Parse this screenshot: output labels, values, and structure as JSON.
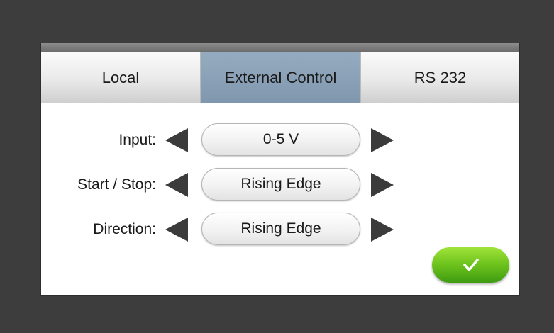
{
  "tabs": [
    {
      "label": "Local",
      "active": false
    },
    {
      "label": "External Control",
      "active": true
    },
    {
      "label": "RS 232",
      "active": false
    }
  ],
  "settings": [
    {
      "label": "Input:",
      "value": "0-5 V"
    },
    {
      "label": "Start / Stop:",
      "value": "Rising Edge"
    },
    {
      "label": "Direction:",
      "value": "Rising Edge"
    }
  ],
  "confirm": {
    "icon": "checkmark-icon"
  },
  "colors": {
    "background": "#3d3d3d",
    "active_tab": "#8aa1b8",
    "confirm_green": "#6cc21c",
    "arrow": "#3b3b3b"
  },
  "icons": {
    "prev": "arrow-left-icon",
    "next": "arrow-right-icon"
  }
}
